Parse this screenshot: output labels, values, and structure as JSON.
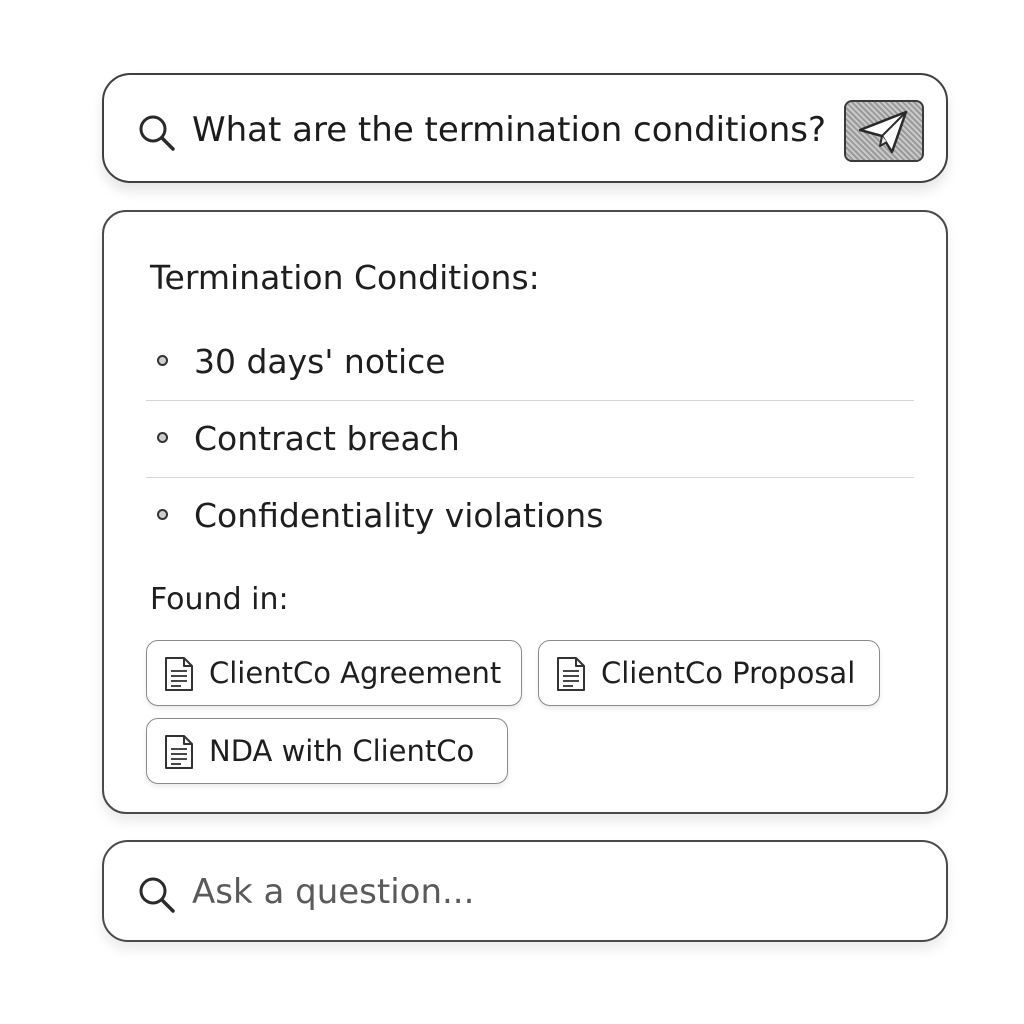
{
  "query_bar": {
    "text": "What are the termination conditions?",
    "search_icon": "search-icon",
    "send_icon": "paper-plane-icon"
  },
  "answer": {
    "heading": "Termination Conditions:",
    "items": [
      {
        "text": "30 days' notice"
      },
      {
        "text": "Contract breach"
      },
      {
        "text": "Confidentiality violations"
      }
    ],
    "found_label": "Found in:",
    "sources": [
      {
        "label": "ClientCo Agreement",
        "icon": "document-icon"
      },
      {
        "label": "ClientCo Proposal",
        "icon": "document-icon"
      },
      {
        "label": "NDA with ClientCo",
        "icon": "document-icon"
      }
    ]
  },
  "ask_bar": {
    "placeholder": "Ask a question...",
    "search_icon": "search-icon"
  },
  "colors": {
    "border": "#3f3f3f",
    "send_button_fill": "#9a9a9a",
    "divider": "#d6d6d6"
  }
}
